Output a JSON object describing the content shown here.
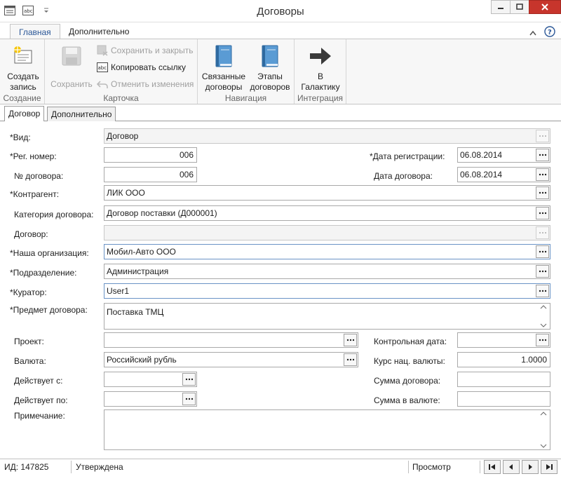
{
  "window": {
    "title": "Договоры"
  },
  "ribbon": {
    "tabs": [
      "Главная",
      "Дополнительно"
    ],
    "groups": {
      "creation": {
        "label": "Создание",
        "create_label_1": "Создать",
        "create_label_2": "запись"
      },
      "card": {
        "label": "Карточка",
        "save_label": "Сохранить",
        "save_close_label": "Сохранить и закрыть",
        "copy_link_label": "Копировать ссылку",
        "undo_label": "Отменить изменения"
      },
      "navigation": {
        "label": "Навигация",
        "related_1": "Связанные",
        "related_2": "договоры",
        "stages_1": "Этапы",
        "stages_2": "договоров"
      },
      "integration": {
        "label": "Интеграция",
        "galaktika_1": "В",
        "galaktika_2": "Галактику"
      }
    }
  },
  "form_tabs": [
    "Договор",
    "Дополнительно"
  ],
  "form": {
    "type_label": "*Вид:",
    "type_value": "Договор",
    "reg_num_label": "*Рег. номер:",
    "reg_num_value": "006",
    "reg_date_label": "*Дата регистрации:",
    "reg_date_value": "06.08.2014",
    "contract_num_label": "№ договора:",
    "contract_num_value": "006",
    "contract_date_label": "Дата договора:",
    "contract_date_value": "06.08.2014",
    "counterparty_label": "*Контрагент:",
    "counterparty_value": "ЛИК ООО",
    "category_label": "Категория договора:",
    "category_value": "Договор поставки (Д000001)",
    "contract_label": "Договор:",
    "contract_value": "",
    "our_org_label": "*Наша организация:",
    "our_org_value": "Мобил-Авто ООО",
    "division_label": "*Подразделение:",
    "division_value": "Администрация",
    "curator_label": "*Куратор:",
    "curator_value": "User1",
    "subject_label": "*Предмет договора:",
    "subject_value": "Поставка ТМЦ",
    "project_label": "Проект:",
    "project_value": "",
    "control_date_label": "Контрольная дата:",
    "control_date_value": "",
    "currency_label": "Валюта:",
    "currency_value": "Российский рубль",
    "rate_label": "Курс нац. валюты:",
    "rate_value": "1.0000",
    "valid_from_label": "Действует с:",
    "valid_from_value": "",
    "amount_label": "Сумма договора:",
    "amount_value": "",
    "valid_to_label": "Действует по:",
    "valid_to_value": "",
    "amount_currency_label": "Сумма в валюте:",
    "amount_currency_value": "",
    "note_label": "Примечание:",
    "note_value": ""
  },
  "status": {
    "id_text": "ИД: 147825",
    "state": "Утверждена",
    "mode": "Просмотр"
  },
  "colors": {
    "accent": "#2b5797",
    "close": "#c7352c",
    "book": "#5a9bd4",
    "arrow": "#3a3a3a"
  }
}
